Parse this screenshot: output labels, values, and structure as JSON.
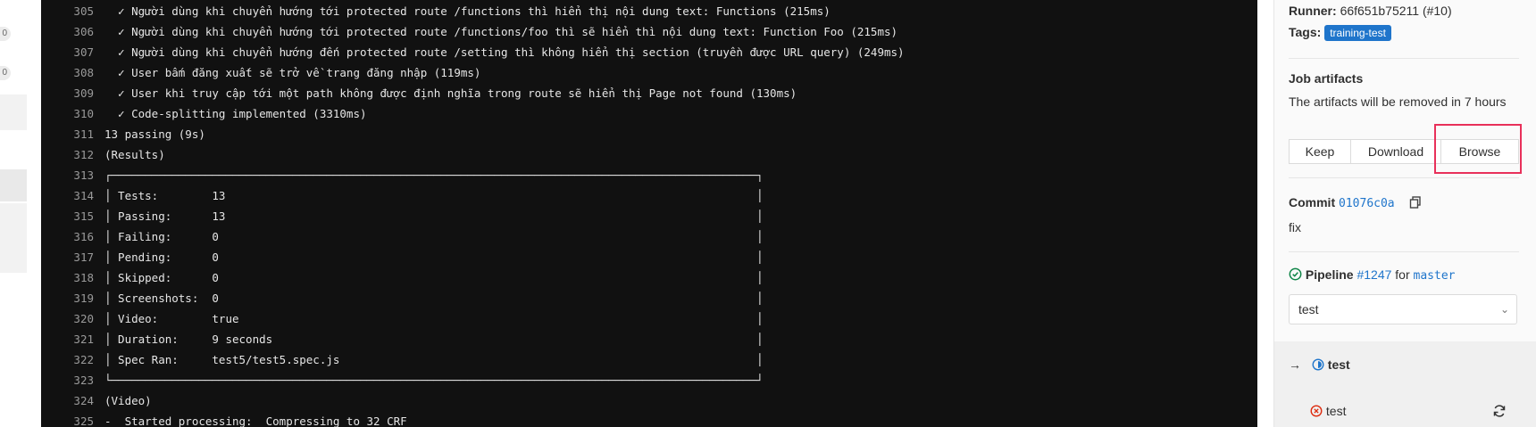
{
  "log_lines": [
    {
      "num": "305",
      "text": "  ✓ Người dùng khi chuyển hướng tới protected route /functions thì hiển thị nội dung text: Functions (215ms)"
    },
    {
      "num": "306",
      "text": "  ✓ Người dùng khi chuyển hướng tới protected route /functions/foo thì sẽ hiển thì nội dung text: Function Foo (215ms)"
    },
    {
      "num": "307",
      "text": "  ✓ Người dùng khi chuyển hướng đến protected route /setting thì không hiển thị section (truyền được URL query) (249ms)"
    },
    {
      "num": "308",
      "text": "  ✓ User bấm đăng xuất sẽ trở về trang đăng nhập (119ms)"
    },
    {
      "num": "309",
      "text": "  ✓ User khi truy cập tới một path không được định nghĩa trong route sẽ hiển thị Page not found (130ms)"
    },
    {
      "num": "310",
      "text": "  ✓ Code-splitting implemented (3310ms)"
    },
    {
      "num": "311",
      "text": "13 passing (9s)"
    },
    {
      "num": "312",
      "text": "(Results)"
    },
    {
      "num": "313",
      "text": "┌────────────────────────────────────────────────────────────────────────────────────────────────┐"
    },
    {
      "num": "314",
      "text": "│ Tests:        13                                                                               │"
    },
    {
      "num": "315",
      "text": "│ Passing:      13                                                                               │"
    },
    {
      "num": "316",
      "text": "│ Failing:      0                                                                                │"
    },
    {
      "num": "317",
      "text": "│ Pending:      0                                                                                │"
    },
    {
      "num": "318",
      "text": "│ Skipped:      0                                                                                │"
    },
    {
      "num": "319",
      "text": "│ Screenshots:  0                                                                                │"
    },
    {
      "num": "320",
      "text": "│ Video:        true                                                                             │"
    },
    {
      "num": "321",
      "text": "│ Duration:     9 seconds                                                                        │"
    },
    {
      "num": "322",
      "text": "│ Spec Ran:     test5/test5.spec.js                                                              │"
    },
    {
      "num": "323",
      "text": "└────────────────────────────────────────────────────────────────────────────────────────────────┘"
    },
    {
      "num": "324",
      "text": "(Video)"
    },
    {
      "num": "325",
      "text": "-  Started processing:  Compressing to 32 CRF"
    }
  ],
  "left_badges": [
    "0",
    "0"
  ],
  "sidebar": {
    "runner_label": "Runner:",
    "runner_value": "66f651b75211 (#10)",
    "tags_label": "Tags:",
    "tag": "training-test",
    "artifacts_heading": "Job artifacts",
    "artifacts_text": "The artifacts will be removed in 7 hours",
    "keep_label": "Keep",
    "download_label": "Download",
    "browse_label": "Browse",
    "commit_label": "Commit",
    "commit_sha": "01076c0a",
    "commit_message": "fix",
    "pipeline_label": "Pipeline",
    "pipeline_id": "#1247",
    "pipeline_for": "for",
    "pipeline_branch": "master",
    "stage_select": "test",
    "stage_arrow": "→",
    "stage_name": "test",
    "job_name": "test"
  },
  "colors": {
    "accent": "#1f75cb",
    "highlight": "#e8305a",
    "success": "#108548",
    "failed": "#dd2b0e"
  }
}
